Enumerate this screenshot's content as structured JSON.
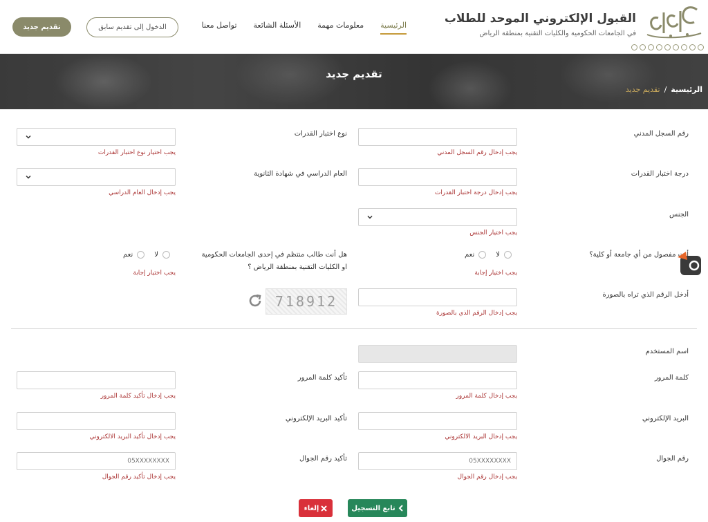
{
  "header": {
    "title": "القبول الإلكتروني الموحد للطلاب",
    "subtitle": "في الجامعات الحكومية والكليات التقنية بمنطقة الرياض",
    "nav": [
      {
        "label": "الرئيسية",
        "active": true
      },
      {
        "label": "معلومات مهمة",
        "active": false
      },
      {
        "label": "الأسئلة الشائعة",
        "active": false
      },
      {
        "label": "تواصل معنا",
        "active": false
      }
    ],
    "login_previous_label": "الدخول إلى تقديم سابق",
    "new_application_label": "تقديم جديد",
    "accent_color": "#8a8a6a"
  },
  "banner": {
    "title": "تقديم جديد",
    "breadcrumb_home": "الرئيسية",
    "breadcrumb_separator": "/",
    "breadcrumb_current": "تقديم جديد"
  },
  "form": {
    "national_id": {
      "label": "رقم السجل المدني",
      "error": "يجب إدخال رقم السجل المدني",
      "value": ""
    },
    "aptitude_type": {
      "label": "نوع اختبار القدرات",
      "error": "يجب اختيار نوع اختبار القدرات",
      "selected": ""
    },
    "aptitude_score": {
      "label": "درجة اختبار القدرات",
      "error": "يجب إدخال درجة اختبار القدرات",
      "value": ""
    },
    "study_year": {
      "label": "العام الدراسي في شهادة الثانوية",
      "error": "يجب إدخال العام الدراسي",
      "selected": ""
    },
    "gender": {
      "label": "الجنس",
      "error": "يجب اختيار الجنس",
      "selected": ""
    },
    "dismissed": {
      "label": "أنت مفصول من أي جامعة أو كلية؟",
      "yes": "نعم",
      "no": "لا",
      "error": "يجب اختيار إجابة"
    },
    "enrolled": {
      "label_line1": "هل أنت طالب منتظم في إحدى الجامعات الحكومية",
      "label_line2": "او الكليات التقنية بمنطقة الرياض ؟",
      "yes": "نعم",
      "no": "لا",
      "error": "يجب اختيار إجابة"
    },
    "captcha": {
      "label": "أدخل الرقم الذي تراه بالصورة",
      "error": "يجب إدخال الرقم الذي بالصورة",
      "image_text": "718912",
      "value": ""
    },
    "username": {
      "label": "اسم المستخدم",
      "value": ""
    },
    "password": {
      "label": "كلمة المرور",
      "error": "يجب إدخال كلمة المرور"
    },
    "password_confirm": {
      "label": "تأكيد كلمة المرور",
      "error": "يجب إدخال تأكيد كلمة المرور"
    },
    "email": {
      "label": "البريد الإلكتروني",
      "error": "يجب إدخال البريد الالكتروني"
    },
    "email_confirm": {
      "label": "تأكيد البريد الإلكتروني",
      "error": "يجب إدخال تأكيد البريد الالكتروني"
    },
    "mobile": {
      "label": "رقم الجوال",
      "error": "يجب إدخال رقم الجوال",
      "placeholder": "05XXXXXXXX"
    },
    "mobile_confirm": {
      "label": "تأكيد رقم الجوال",
      "error": "يجب إدخال تأكيد رقم الجوال",
      "placeholder": "05XXXXXXXX"
    }
  },
  "actions": {
    "submit_label": "تابع التسجيل",
    "cancel_label": "إلغاء",
    "submit_color": "#27875a",
    "cancel_color": "#d9303a",
    "error_color": "#aa3333"
  }
}
